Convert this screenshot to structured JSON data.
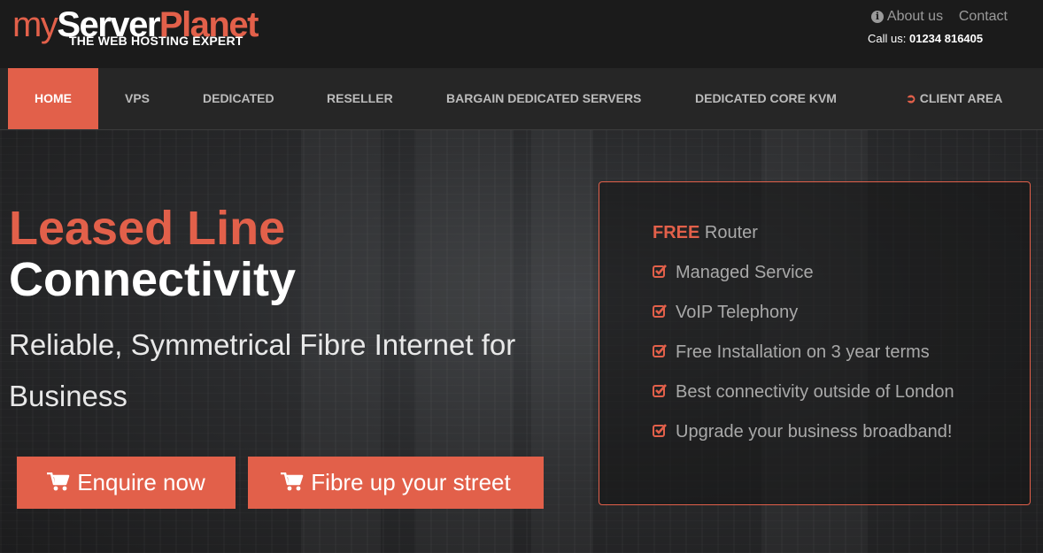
{
  "logo": {
    "part1": "my",
    "part2": "Server",
    "part3": "Planet",
    "tagline": "THE WEB HOSTING EXPERT"
  },
  "header": {
    "about_label": "About us",
    "contact_label": "Contact",
    "call_label": "Call us:",
    "phone": "01234 816405"
  },
  "nav": {
    "items": [
      {
        "label": "HOME"
      },
      {
        "label": "VPS"
      },
      {
        "label": "DEDICATED"
      },
      {
        "label": "RESELLER"
      },
      {
        "label": "BARGAIN DEDICATED SERVERS"
      },
      {
        "label": "DEDICATED CORE KVM"
      },
      {
        "label": "CLIENT AREA"
      }
    ]
  },
  "hero": {
    "title_line1": "Leased Line",
    "title_line2": "Connectivity",
    "subtitle": "Reliable, Symmetrical Fibre Internet for Business",
    "buttons": {
      "enquire": "Enquire now",
      "fibre": "Fibre up your street"
    }
  },
  "features": {
    "free_word": "FREE",
    "free_item": "Router",
    "items": [
      "Managed Service",
      "VoIP Telephony",
      "Free Installation on 3 year terms",
      "Best connectivity outside of London",
      "Upgrade your business broadband!"
    ]
  },
  "colors": {
    "accent": "#e2604a",
    "nav_bg": "#262626",
    "top_bg": "#1b1b1b"
  },
  "icons": [
    "info-icon",
    "login-icon",
    "cart-icon",
    "check-icon"
  ]
}
